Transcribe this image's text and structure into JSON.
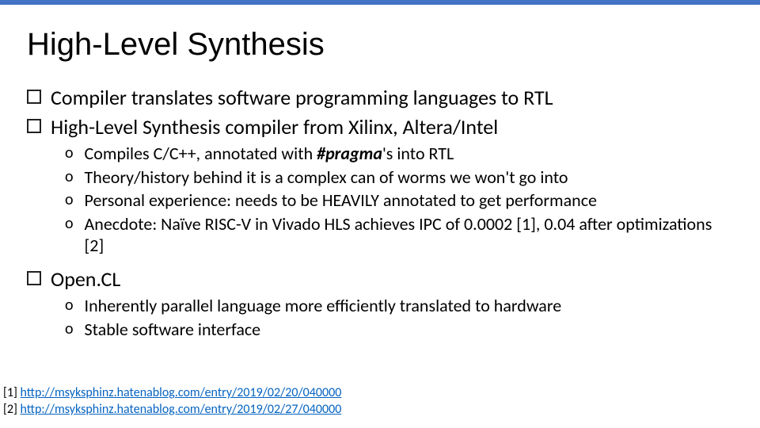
{
  "title": "High-Level Synthesis",
  "b1": "Compiler translates software programming languages to RTL",
  "b2": "High-Level Synthesis compiler from Xilinx, Altera/Intel",
  "b2s1a": "Compiles C/C++, annotated with ",
  "b2s1b": "#pragma",
  "b2s1c": "'s into RTL",
  "b2s2": "Theory/history behind it is a complex can of worms we won't go into",
  "b2s3": "Personal experience: needs to be HEAVILY annotated to get performance",
  "b2s4": "Anecdote: Naïve RISC-V in Vivado HLS achieves IPC of 0.0002 [1], 0.04 after optimizations [2]",
  "b3": "Open.CL",
  "b3s1": "Inherently parallel language more efficiently translated to hardware",
  "b3s2": "Stable software interface",
  "ref1label": "[1] ",
  "ref1url": "http://msyksphinz.hatenablog.com/entry/2019/02/20/040000",
  "ref2label": "[2] ",
  "ref2url": "http://msyksphinz.hatenablog.com/entry/2019/02/27/040000"
}
